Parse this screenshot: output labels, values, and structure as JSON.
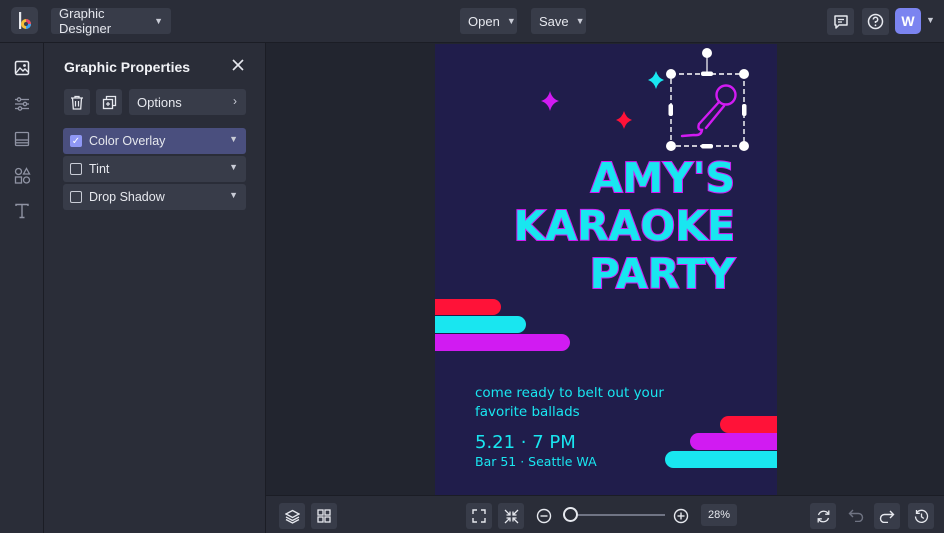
{
  "topbar": {
    "app_menu_label": "Graphic Designer",
    "open_label": "Open",
    "save_label": "Save",
    "avatar_initial": "W"
  },
  "panel": {
    "title": "Graphic Properties",
    "options_label": "Options",
    "effects": [
      {
        "label": "Color Overlay",
        "checked": true
      },
      {
        "label": "Tint",
        "checked": false
      },
      {
        "label": "Drop Shadow",
        "checked": false
      }
    ]
  },
  "poster": {
    "heading_lines": [
      "AMY'S",
      "KARAOKE",
      "PARTY"
    ],
    "invite_line1": "come ready to belt out your",
    "invite_line2": "favorite ballads",
    "date_time": "5.21 · 7 PM",
    "venue": "Bar 51 · Seattle WA",
    "colors": {
      "background": "#201d4b",
      "cyan": "#19e6f0",
      "magenta": "#d11bf2",
      "red": "#ff1238"
    }
  },
  "zoom": {
    "percent_label": "28%",
    "level": 0.28
  }
}
